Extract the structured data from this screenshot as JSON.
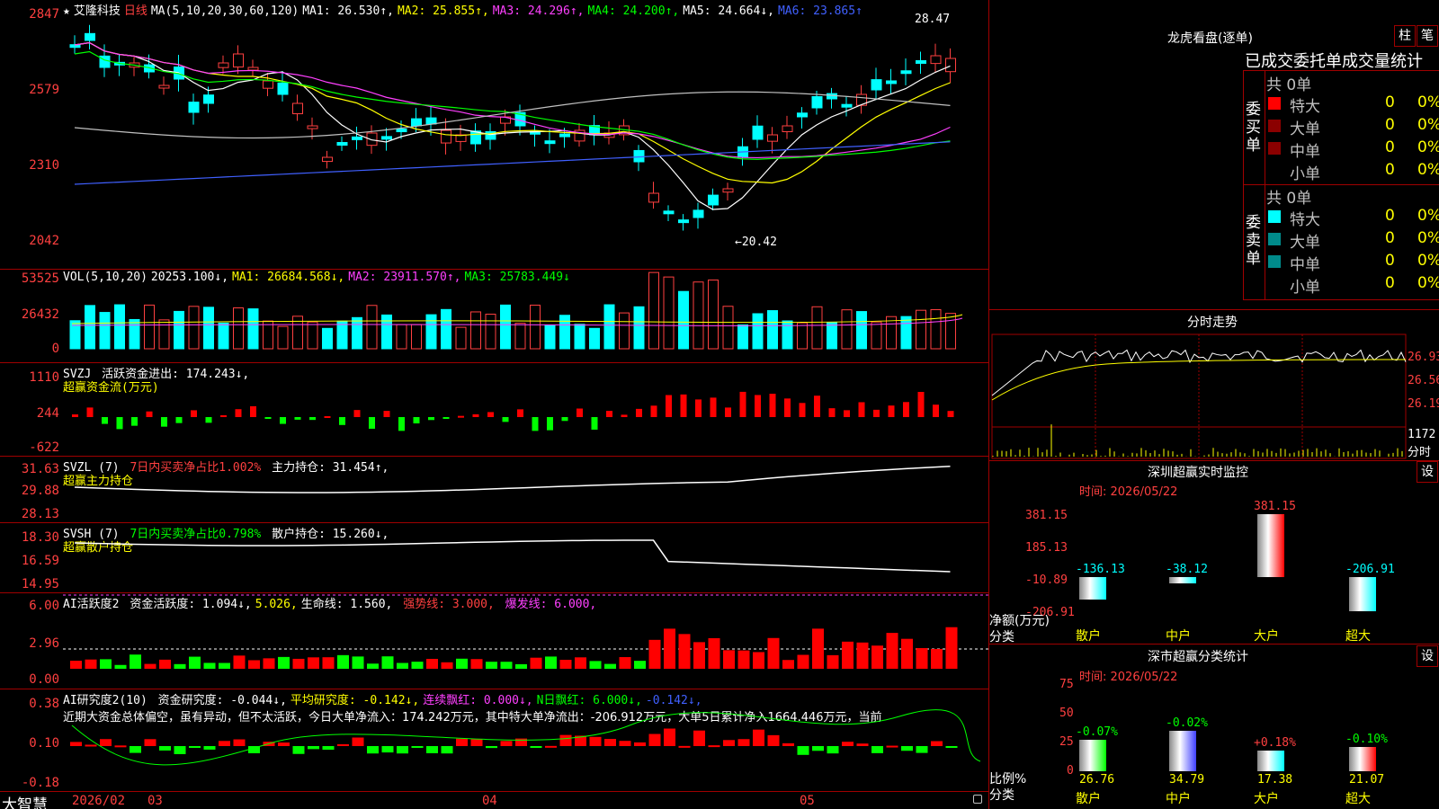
{
  "stock": {
    "name": "艾隆科技",
    "period": "日线",
    "ma_header": "MA(5,10,20,30,60,120)",
    "ma1": "MA1: 26.530↑,",
    "ma2": "MA2: 25.855↑,",
    "ma3": "MA3: 24.296↑,",
    "ma4": "MA4: 24.200↑,",
    "ma5": "MA5: 24.664↓,",
    "ma6": "MA6: 23.865↑",
    "high_label": "28.47",
    "low_label": "←20.42",
    "price_axis": [
      "2847",
      "2579",
      "2310",
      "2042"
    ]
  },
  "vol": {
    "header": "VOL(5,10,20)",
    "v": "20253.100↓,",
    "ma1": "MA1: 26684.568↓,",
    "ma2": "MA2: 23911.570↑,",
    "ma3": "MA3: 25783.449↓",
    "axis": [
      "53525",
      "26432",
      "0"
    ]
  },
  "svzj": {
    "header": "SVZJ",
    "text": "活跃资金进出: 174.243↓,",
    "sub": "超赢资金流(万元)",
    "axis": [
      "1110",
      "244",
      "-622"
    ]
  },
  "svzl": {
    "header": "SVZL (7)",
    "text1": "7日内买卖净占比1.002%",
    "text2": "主力持仓: 31.454↑,",
    "sub": "超赢主力持仓",
    "axis": [
      "31.63",
      "29.88",
      "28.13"
    ]
  },
  "svsh": {
    "header": "SVSH (7)",
    "text1": "7日内买卖净占比0.798%",
    "text2": "散户持仓: 15.260↓,",
    "sub": "超赢散户持仓",
    "axis": [
      "18.30",
      "16.59",
      "14.95"
    ]
  },
  "ai1": {
    "header": "AI活跃度2",
    "t1": "资金活跃度: 1.094↓,",
    "t2": "5.026,",
    "t3": "生命线: 1.560,",
    "t4": "强势线: 3.000,",
    "t5": "爆发线: 6.000,",
    "axis": [
      "6.00",
      "2.96",
      "0.00"
    ]
  },
  "ai2": {
    "header": "AI研究度2(10)",
    "t1": "资金研究度: -0.044↓,",
    "t2": "平均研究度: -0.142↓,",
    "t3": "连续飘红: 0.000↓,",
    "t4": "N日飘红: 6.000↓,",
    "t5": "-0.142↓,",
    "note": "近期大资金总体偏空，虽有异动，但不太活跃，今日大单净流入：174.242万元，其中特大单净流出：-206.912万元，大单5日累计净入1664.446万元，当前",
    "axis": [
      "0.38",
      "0.10",
      "-0.18"
    ]
  },
  "bottom": {
    "brand": "大智慧",
    "dates": [
      "2026/02",
      "03",
      "04",
      "05"
    ]
  },
  "dragon": {
    "title": "龙虎看盘(逐单)",
    "btn1": "柱",
    "btn2": "笔",
    "heading": "已成交委托单成交量统计",
    "buy_label": "委买单",
    "sell_label": "委卖单",
    "buy_total": "共 0单",
    "sell_total": "共 0单",
    "rows": [
      "特大",
      "大单",
      "中单",
      "小单"
    ],
    "zero": "0",
    "pct": "0%",
    "buy_colors": [
      "#ff0000",
      "#8b0000",
      "#8b0000",
      "#000000"
    ],
    "sell_colors": [
      "#00ffff",
      "#008b8b",
      "#008b8b",
      "#000000"
    ]
  },
  "intraday": {
    "title": "分时走势",
    "axis": [
      "26.93",
      "26.56",
      "26.19"
    ],
    "vol_label": "1172",
    "vol_unit": "分时"
  },
  "monitor": {
    "title": "深圳超赢实时监控",
    "settings": "设",
    "time": "时间: 2026/05/22",
    "axis": [
      "381.15",
      "185.13",
      "-10.89",
      "-206.91"
    ],
    "side1": "净额(万元)",
    "side2": "分类",
    "bars": [
      {
        "label": "散户",
        "value": "-136.13"
      },
      {
        "label": "中户",
        "value": "-38.12"
      },
      {
        "label": "大户",
        "value": "381.15"
      },
      {
        "label": "超大",
        "value": "-206.91"
      }
    ]
  },
  "stats": {
    "title": "深市超赢分类统计",
    "settings": "设",
    "time": "时间: 2026/05/22",
    "axis": [
      "75",
      "50",
      "25",
      "0"
    ],
    "side1": "比例%",
    "side2": "分类",
    "bars": [
      {
        "label": "散户",
        "pct": "26.76",
        "chg": "-0.07%"
      },
      {
        "label": "中户",
        "pct": "34.79",
        "chg": "-0.02%"
      },
      {
        "label": "大户",
        "pct": "17.38",
        "chg": "+0.18%"
      },
      {
        "label": "超大",
        "pct": "21.07",
        "chg": "-0.10%"
      }
    ]
  }
}
